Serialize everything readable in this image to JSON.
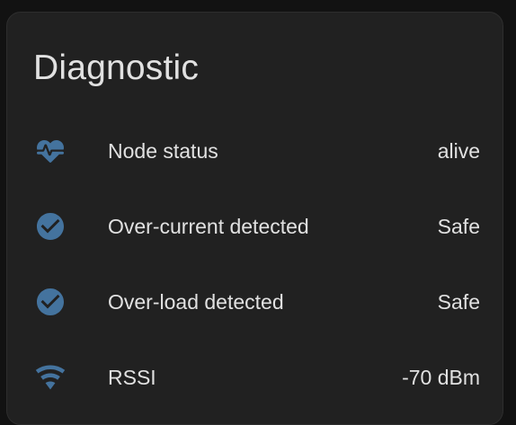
{
  "card": {
    "title": "Diagnostic",
    "rows": [
      {
        "icon": "heart-pulse-icon",
        "label": "Node status",
        "value": "alive"
      },
      {
        "icon": "check-circle-icon",
        "label": "Over-current detected",
        "value": "Safe"
      },
      {
        "icon": "check-circle-icon",
        "label": "Over-load detected",
        "value": "Safe"
      },
      {
        "icon": "wifi-icon",
        "label": "RSSI",
        "value": "-70 dBm"
      }
    ]
  },
  "colors": {
    "background": "#121212",
    "card": "#212121",
    "text": "#e1e1e1",
    "icon": "#44739e"
  }
}
